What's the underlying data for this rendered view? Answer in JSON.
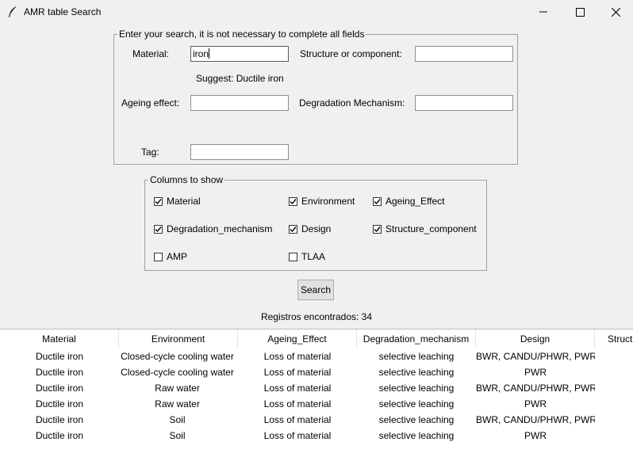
{
  "window": {
    "title": "AMR table Search"
  },
  "search": {
    "legend": "Enter your search, it is not necessary to complete all fields",
    "material_label": "Material:",
    "material_value": "iron",
    "suggest_text": "Suggest: Ductile iron",
    "structure_label": "Structure or component:",
    "structure_value": "",
    "ageing_label": "Ageing effect:",
    "ageing_value": "",
    "degradation_label": "Degradation Mechanism:",
    "degradation_value": "",
    "tag_label": "Tag:",
    "tag_value": ""
  },
  "columns": {
    "legend": "Columns to show",
    "options": [
      {
        "label": "Material",
        "checked": true
      },
      {
        "label": "Environment",
        "checked": true
      },
      {
        "label": "Ageing_Effect",
        "checked": true
      },
      {
        "label": "Degradation_mechanism",
        "checked": true
      },
      {
        "label": "Design",
        "checked": true
      },
      {
        "label": "Structure_component",
        "checked": true
      },
      {
        "label": "AMP",
        "checked": false
      },
      {
        "label": "TLAA",
        "checked": false
      }
    ]
  },
  "search_button": "Search",
  "records_text": "Registros encontrados: 34",
  "table": {
    "headers": [
      "Material",
      "Environment",
      "Ageing_Effect",
      "Degradation_mechanism",
      "Design",
      "Struct"
    ],
    "rows": [
      [
        "Ductile iron",
        "Closed-cycle cooling water",
        "Loss of material",
        "selective leaching",
        "BWR, CANDU/PHWR, PWR"
      ],
      [
        "Ductile iron",
        "Closed-cycle cooling water",
        "Loss of material",
        "selective leaching",
        "PWR"
      ],
      [
        "Ductile iron",
        "Raw water",
        "Loss of material",
        "selective leaching",
        "BWR, CANDU/PHWR, PWR"
      ],
      [
        "Ductile iron",
        "Raw water",
        "Loss of material",
        "selective leaching",
        "PWR"
      ],
      [
        "Ductile iron",
        "Soil",
        "Loss of material",
        "selective leaching",
        "BWR, CANDU/PHWR, PWR"
      ],
      [
        "Ductile iron",
        "Soil",
        "Loss of material",
        "selective leaching",
        "PWR"
      ]
    ]
  },
  "icons": {
    "app": "feather-icon",
    "minimize": "minimize-icon",
    "maximize": "maximize-icon",
    "close": "close-icon",
    "check": "checkmark-icon"
  }
}
